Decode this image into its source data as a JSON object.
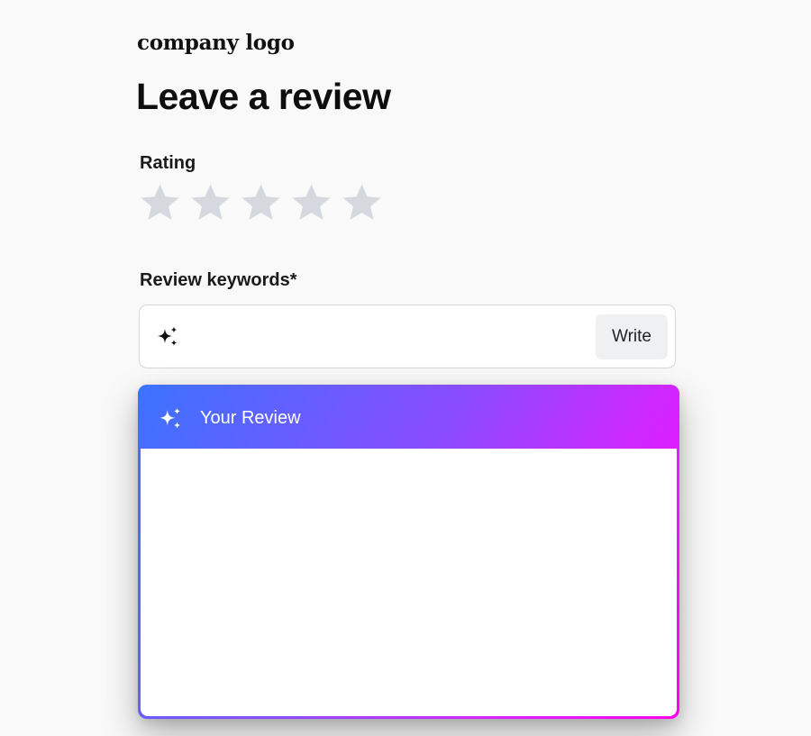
{
  "brand": {
    "logo_text": "company logo"
  },
  "page": {
    "title": "Leave a review"
  },
  "rating": {
    "label": "Rating",
    "value": 0,
    "max": 5,
    "star_icon": "star-icon",
    "empty_color": "#d5d8de"
  },
  "keywords": {
    "label": "Review keywords*",
    "value": "",
    "placeholder": "",
    "icon": "sparkle-icon",
    "write_label": "Write"
  },
  "review": {
    "header_label": "Your Review",
    "icon": "sparkle-icon",
    "value": "",
    "gradient_start": "#3b73ff",
    "gradient_end": "#ff00ee"
  }
}
